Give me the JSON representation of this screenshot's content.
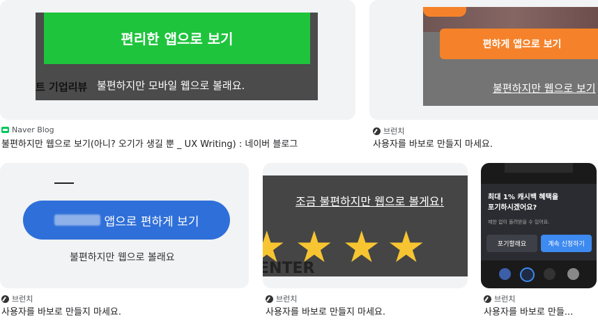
{
  "results": [
    {
      "source": "Naver Blog",
      "title": "불편하지만 웹으로 보기(아니? 오기가 생길 뿐 _ UX Writing) : 네이버 블로그",
      "thumb": {
        "primary_button": "편리한 앱으로 보기",
        "side_text": "트 기업리뷰",
        "secondary_text": "불편하지만 모바일 웹으로 볼래요."
      }
    },
    {
      "source": "브런치",
      "title": "사용자를 바보로 만들지 마세요.",
      "thumb": {
        "primary_button": "편하게 앱으로 보기",
        "secondary_text": "불편하지만 웹으로 보기"
      }
    },
    {
      "source": "브런치",
      "title": "사용자를 바보로 만들지 마세요.",
      "thumb": {
        "primary_button": "앱으로 편하게 보기",
        "secondary_text": "불편하지만 웹으로 볼래요"
      }
    },
    {
      "source": "브런치",
      "title": "사용자를 바보로 만들지 마세요.",
      "thumb": {
        "headline": "조금 불편하지만 웹으로 볼게요!",
        "star_count": 4,
        "bottom_text": "ENTER"
      }
    },
    {
      "source": "브런치",
      "title": "사용자를 바보로 만들...",
      "thumb": {
        "dialog_title": "최대 1% 캐시백 혜택을 포기하시겠어요?",
        "dialog_sub": "제한 없이 돌려받을 수 있어요.",
        "cancel_button": "포기할래요",
        "confirm_button": "계속 신청하기"
      }
    }
  ],
  "colors": {
    "naver_green": "#1ec43c",
    "orange": "#f5822a",
    "blue": "#2f6fd9",
    "dialog_blue": "#3d8af0"
  }
}
